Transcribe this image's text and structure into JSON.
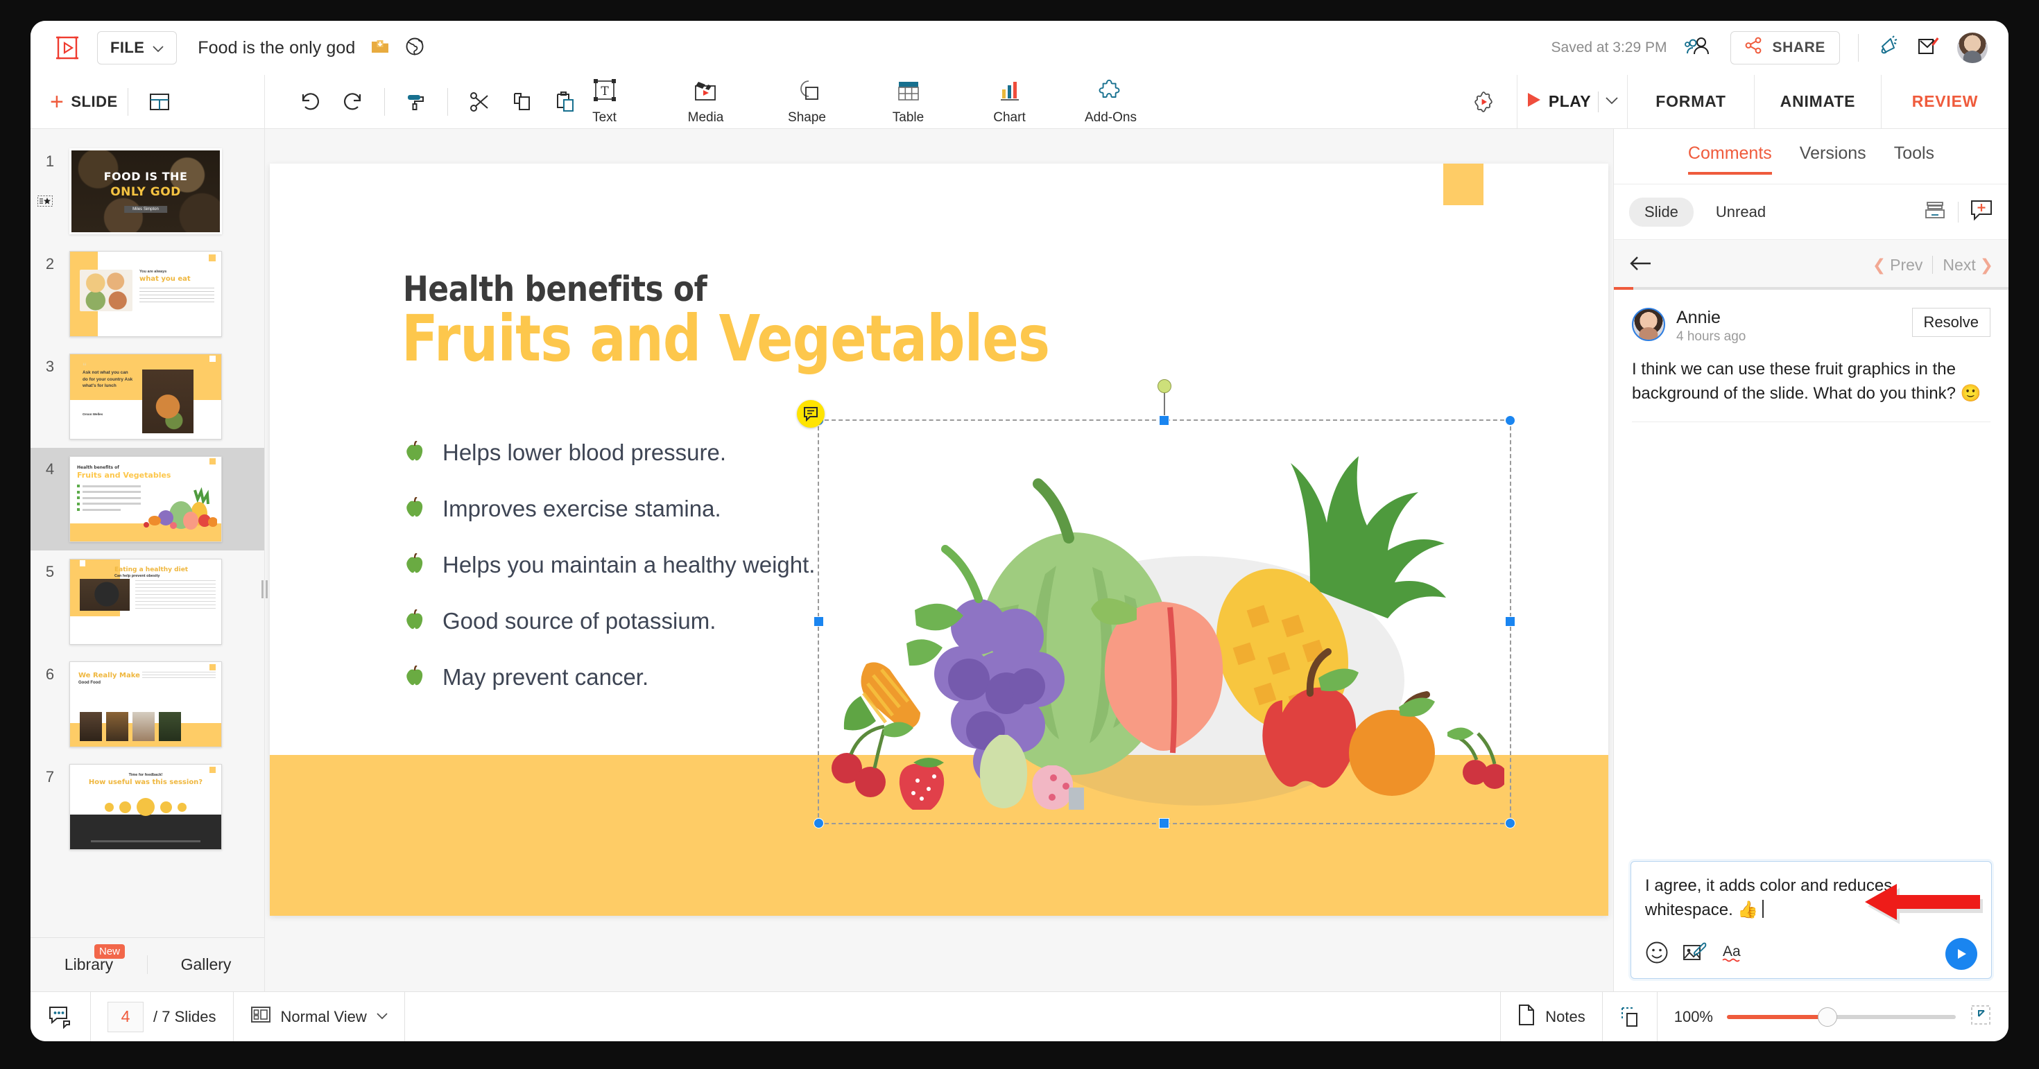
{
  "topbar": {
    "file_label": "FILE",
    "doc_title": "Food is the only god",
    "saved_text": "Saved at 3:29 PM",
    "share_label": "SHARE"
  },
  "toolbar": {
    "add_slide_label": "SLIDE",
    "insert_items": [
      {
        "label": "Text",
        "icon": "text-box-icon"
      },
      {
        "label": "Media",
        "icon": "clapperboard-icon"
      },
      {
        "label": "Shape",
        "icon": "shape-icon"
      },
      {
        "label": "Table",
        "icon": "table-icon"
      },
      {
        "label": "Chart",
        "icon": "bar-chart-icon"
      },
      {
        "label": "Add-Ons",
        "icon": "puzzle-piece-icon"
      }
    ],
    "play_label": "PLAY",
    "tabs": [
      {
        "label": "FORMAT",
        "active": false
      },
      {
        "label": "ANIMATE",
        "active": false
      },
      {
        "label": "REVIEW",
        "active": true
      }
    ]
  },
  "slide_panel": {
    "slides": [
      {
        "num": "1",
        "title_a": "FOOD IS THE",
        "title_b": "ONLY GOD",
        "byline": "Miles Simpton"
      },
      {
        "num": "2",
        "eyebrow": "You are always",
        "title": "what you eat"
      },
      {
        "num": "3",
        "quote": "Ask not what you can do for your country  Ask what's for lunch",
        "author": "Orson Welles"
      },
      {
        "num": "4",
        "eyebrow": "Health benefits of",
        "title": "Fruits and Vegetables"
      },
      {
        "num": "5",
        "title": "Eating a healthy diet",
        "subtitle": "Can help prevent obesity"
      },
      {
        "num": "6",
        "title": "We Really Make",
        "subtitle": "Good Food"
      },
      {
        "num": "7",
        "eyebrow": "Time for feedback!",
        "title": "How useful was this session?"
      }
    ],
    "selected": "4",
    "tabs": [
      {
        "label": "Library",
        "badge": "New"
      },
      {
        "label": "Gallery",
        "badge": ""
      }
    ]
  },
  "slide": {
    "title_line1": "Health benefits of",
    "title_line2": "Fruits and Vegetables",
    "bullets": [
      "Helps lower blood pressure.",
      "Improves exercise stamina.",
      "Helps you maintain a healthy weight.",
      "Good source of potassium.",
      "May prevent cancer."
    ],
    "accent_color": "#fecc66",
    "title_color": "#fdc74c"
  },
  "comments_panel": {
    "tabs": [
      {
        "label": "Comments",
        "active": true
      },
      {
        "label": "Versions",
        "active": false
      },
      {
        "label": "Tools",
        "active": false
      }
    ],
    "filters": [
      {
        "label": "Slide",
        "active": true
      },
      {
        "label": "Unread",
        "active": false
      }
    ],
    "nav": {
      "prev": "Prev",
      "next": "Next"
    },
    "comment": {
      "author": "Annie",
      "time": "4 hours ago",
      "resolve_label": "Resolve",
      "text": "I think we can use these fruit graphics in the background of the slide. What do you think? 🙂"
    },
    "composer": {
      "value": "I agree, it adds color and reduces whitespace. 👍",
      "tools": [
        "emoji-icon",
        "attach-image-icon",
        "text-format-icon"
      ],
      "send_icon": "send-icon"
    }
  },
  "statusbar": {
    "current_slide": "4",
    "slide_count_label": "/ 7 Slides",
    "view_label": "Normal View",
    "notes_label": "Notes",
    "zoom_label": "100%"
  },
  "colors": {
    "accent_red": "#ef5b3c",
    "accent_yellow": "#fecc66",
    "accent_blue": "#1a85f0",
    "teal": "#17708f"
  }
}
